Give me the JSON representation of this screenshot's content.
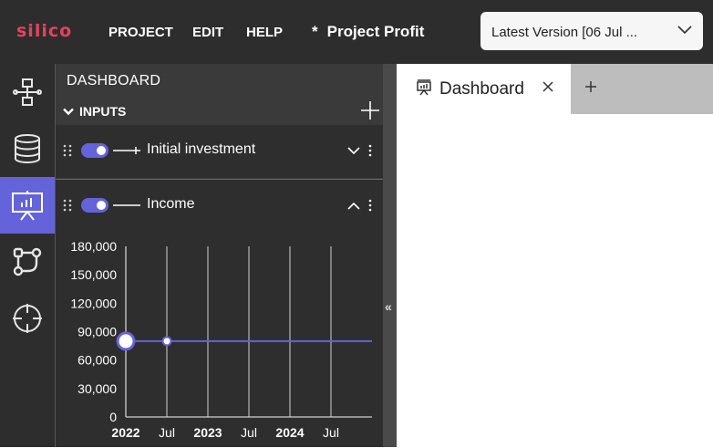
{
  "app": {
    "logo": "silico"
  },
  "menu": [
    "PROJECT",
    "EDIT",
    "HELP"
  ],
  "project": {
    "modified_marker": "*",
    "name": "Project Profit"
  },
  "version_select": {
    "value": "Latest Version  [06 Jul ..."
  },
  "rail": {
    "items": [
      {
        "icon": "flowchart-icon"
      },
      {
        "icon": "database-icon"
      },
      {
        "icon": "dashboard-presentation-icon",
        "active": true
      },
      {
        "icon": "connections-icon"
      },
      {
        "icon": "crosshair-icon"
      }
    ]
  },
  "panel": {
    "title": "DASHBOARD",
    "section": "INPUTS",
    "cards": [
      {
        "name": "Initial investment",
        "enabled": true,
        "expanded": false
      },
      {
        "name": "Income",
        "enabled": true,
        "expanded": true
      }
    ]
  },
  "chart_data": {
    "type": "line",
    "title": "",
    "xlabel": "",
    "ylabel": "",
    "x_ticks": [
      "2022",
      "Jul",
      "2023",
      "Jul",
      "2024",
      "Jul"
    ],
    "y_ticks": [
      "180,000",
      "150,000",
      "120,000",
      "90,000",
      "60,000",
      "30,000",
      "0"
    ],
    "ylim": [
      0,
      180000
    ],
    "grid": "vertical",
    "series": [
      {
        "color": "#6463d9",
        "points": [
          {
            "x": "2022-01",
            "y": 80000
          },
          {
            "x": "2022-07",
            "y": 80000
          }
        ]
      }
    ]
  },
  "collapse_icon": "«",
  "tabs": [
    {
      "label": "Dashboard"
    }
  ],
  "new_tab_icon": "+",
  "colors": {
    "accent": "#6463d9",
    "logo": "#e2445b",
    "topbar": "#2d2d2d"
  }
}
